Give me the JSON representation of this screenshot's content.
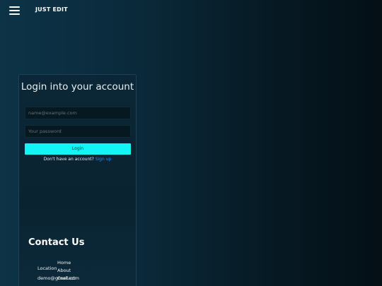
{
  "header": {
    "brand": "JUST EDIT",
    "menu_icon": "hamburger-menu-icon"
  },
  "login": {
    "title": "Login into your account",
    "email_placeholder": "name@example.com",
    "password_placeholder": "Your password",
    "submit_label": "Login",
    "signup_prompt": "Don't have an account?",
    "signup_link": "Sign up"
  },
  "footer": {
    "contact_title": "Contact Us",
    "location_label": "Location",
    "email": "demo@gmail.com",
    "links": [
      "Home",
      "About",
      "Contact"
    ]
  },
  "colors": {
    "accent": "#12f4f6",
    "link": "#2f8dde"
  }
}
